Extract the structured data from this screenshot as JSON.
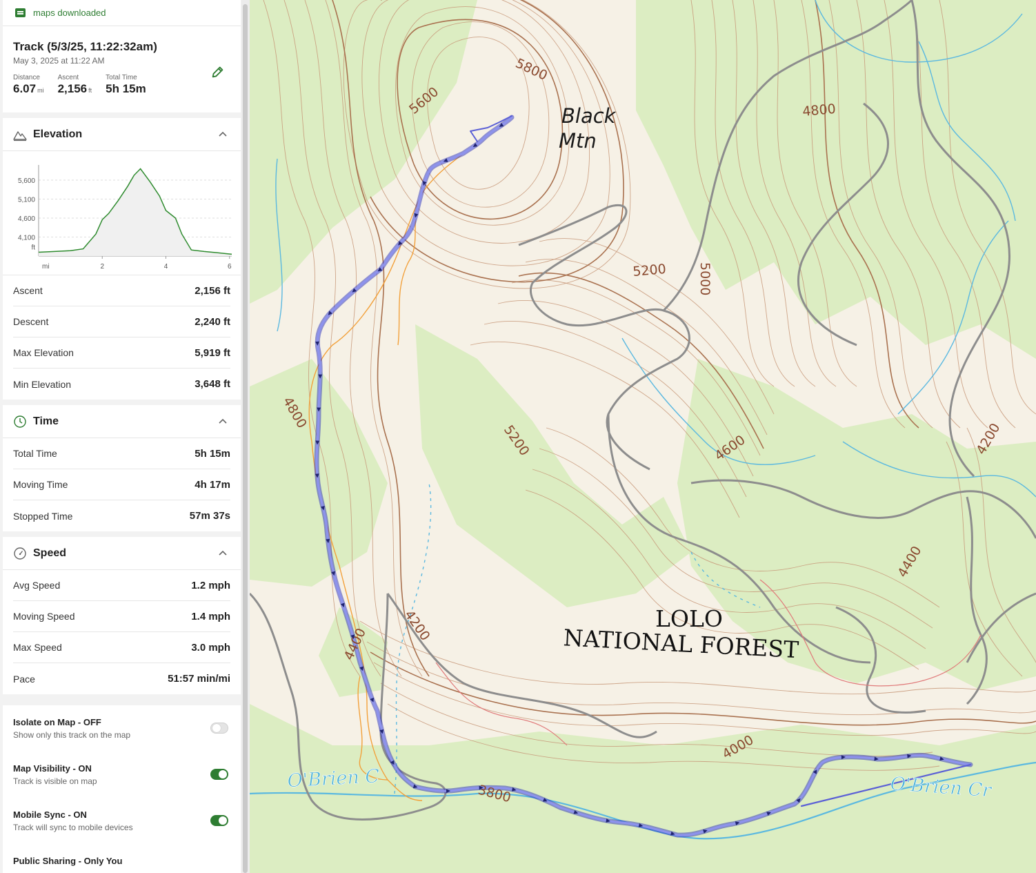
{
  "topbar": {
    "status": "maps downloaded",
    "icon": "folder-icon"
  },
  "track": {
    "title": "Track (5/3/25, 11:22:32am)",
    "date": "May 3, 2025 at 11:22 AM",
    "stats": [
      {
        "label": "Distance",
        "value": "6.07",
        "unit": "mi"
      },
      {
        "label": "Ascent",
        "value": "2,156",
        "unit": "ft"
      },
      {
        "label": "Total Time",
        "value": "5h 15m",
        "unit": ""
      }
    ]
  },
  "elevation": {
    "title": "Elevation",
    "chart_data": {
      "type": "area",
      "yticks": [
        "5,600",
        "5,100",
        "4,600",
        "4,100"
      ],
      "yunit": "ft",
      "xticks": [
        "2",
        "4",
        "6"
      ],
      "xunit": "mi",
      "x": [
        0,
        0.5,
        1.0,
        1.4,
        1.8,
        2.0,
        2.2,
        2.5,
        2.8,
        3.0,
        3.2,
        3.5,
        3.8,
        4.0,
        4.3,
        4.5,
        4.8,
        5.2,
        5.6,
        6.07
      ],
      "y": [
        3700,
        3720,
        3740,
        3790,
        4180,
        4560,
        4720,
        5060,
        5440,
        5730,
        5900,
        5560,
        5180,
        4800,
        4600,
        4180,
        3760,
        3720,
        3690,
        3648
      ],
      "ylim": [
        3600,
        6000
      ],
      "xlim": [
        0,
        6.07
      ],
      "color": "#2e8b2e"
    },
    "rows": [
      {
        "label": "Ascent",
        "value": "2,156 ft"
      },
      {
        "label": "Descent",
        "value": "2,240 ft"
      },
      {
        "label": "Max Elevation",
        "value": "5,919 ft"
      },
      {
        "label": "Min Elevation",
        "value": "3,648 ft"
      }
    ]
  },
  "time": {
    "title": "Time",
    "rows": [
      {
        "label": "Total Time",
        "value": "5h 15m"
      },
      {
        "label": "Moving Time",
        "value": "4h 17m"
      },
      {
        "label": "Stopped Time",
        "value": "57m 37s"
      }
    ]
  },
  "speed": {
    "title": "Speed",
    "rows": [
      {
        "label": "Avg Speed",
        "value": "1.2 mph"
      },
      {
        "label": "Moving Speed",
        "value": "1.4 mph"
      },
      {
        "label": "Max Speed",
        "value": "3.0 mph"
      },
      {
        "label": "Pace",
        "value": "51:57 min/mi"
      }
    ]
  },
  "toggles": [
    {
      "label": "Isolate on Map - OFF",
      "desc": "Show only this track on the map",
      "on": false
    },
    {
      "label": "Map Visibility - ON",
      "desc": "Track is visible on map",
      "on": true
    },
    {
      "label": "Mobile Sync - ON",
      "desc": "Track will sync to mobile devices",
      "on": true
    },
    {
      "label": "Public Sharing - Only You",
      "desc": "",
      "on": false
    }
  ],
  "map": {
    "labels": {
      "peak_line1": "Black",
      "peak_line2": "Mtn",
      "forest_line1": "LOLO",
      "forest_line2": "NATIONAL FOREST",
      "creek1": "O'Brien C",
      "creek2": "O'Brien Cr"
    },
    "contours": [
      "5800",
      "5600",
      "5200",
      "5200",
      "5000",
      "4800",
      "4800",
      "4600",
      "4400",
      "4400",
      "4200",
      "4200",
      "4000",
      "3800"
    ],
    "colors": {
      "track": "#5a5fd6",
      "contour": "#b07a5a",
      "road": "#8c8c8c",
      "water": "#4fb3d9",
      "vegetation": "#dbedc1"
    }
  }
}
